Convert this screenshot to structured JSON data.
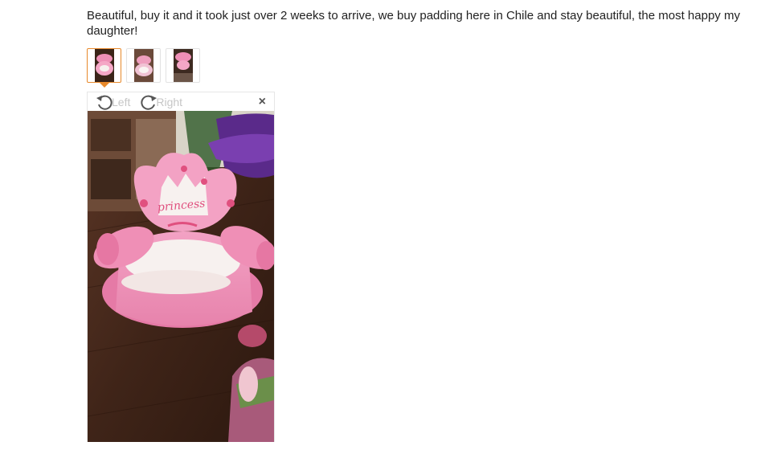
{
  "review": {
    "text": "Beautiful, buy it and it took just over 2 weeks to arrive, we buy padding here in Chile and stay beautiful, the most happy my daughter!"
  },
  "thumbnails": [
    {
      "name": "thumbnail-1",
      "selected": true
    },
    {
      "name": "thumbnail-2",
      "selected": false
    },
    {
      "name": "thumbnail-3",
      "selected": false
    }
  ],
  "viewer": {
    "rotate_left_label": "Left",
    "rotate_right_label": "Right",
    "close_symbol": "×",
    "photo_text": "princess"
  },
  "colors": {
    "accent": "#e8892b",
    "toolbar_text": "#c6c6c6",
    "chair_pink": "#f08fb6",
    "chair_white": "#f7f1ef",
    "floor": "#4a2a1a"
  }
}
